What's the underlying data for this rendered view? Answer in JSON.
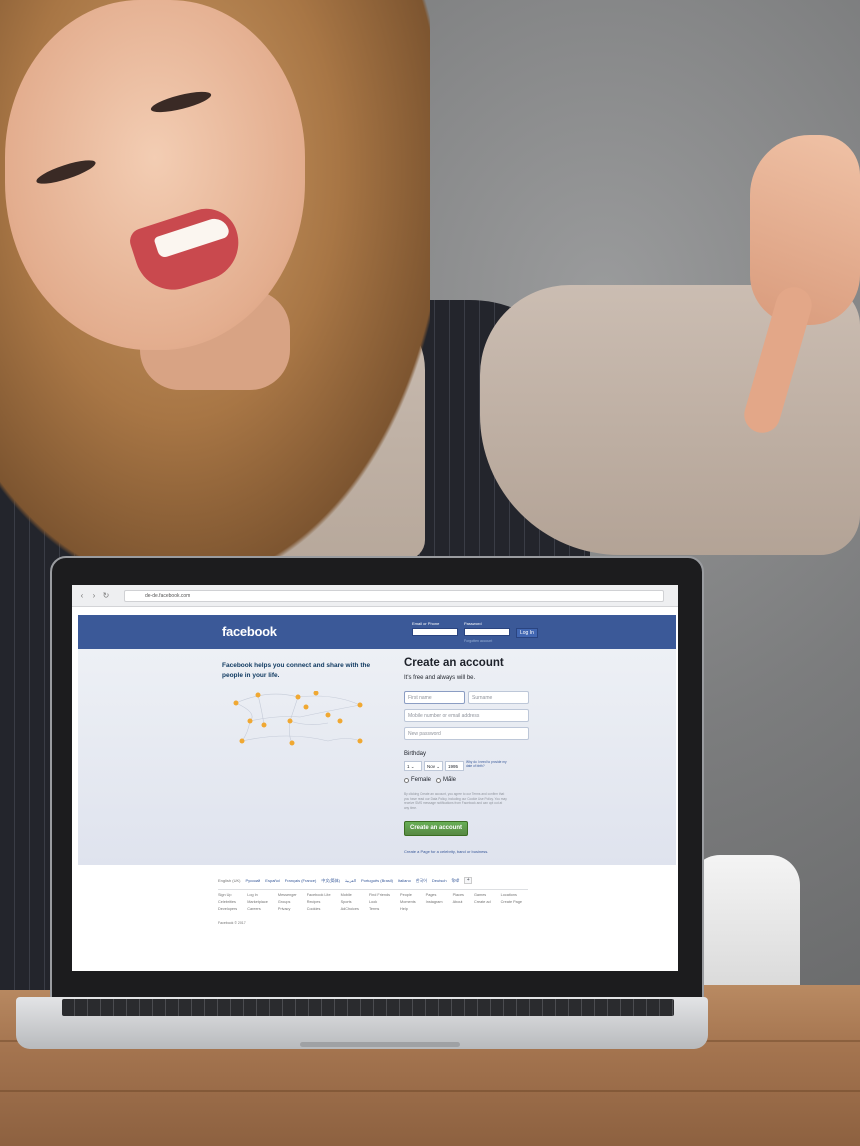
{
  "browser": {
    "url": "de-de.facebook.com",
    "nav_icons": [
      "back-arrow-icon",
      "forward-arrow-icon",
      "reload-icon"
    ]
  },
  "header": {
    "logo": "facebook",
    "email_label": "Email or Phone",
    "password_label": "Password",
    "login_button": "Log In",
    "forgot_link": "Forgotten account"
  },
  "main": {
    "tagline": "Facebook helps you connect and share with the people in your life.",
    "signup_title": "Create an account",
    "signup_subtitle": "It's free and always will be.",
    "first_name_placeholder": "First name",
    "surname_placeholder": "Surname",
    "mobile_placeholder": "Mobile number or email address",
    "password_placeholder": "New password",
    "birthday_label": "Birthday",
    "birthday_day": "1",
    "birthday_month": "Nov",
    "birthday_year": "1995",
    "why_birthday": "Why do I need to provide my date of birth?",
    "gender_female": "Female",
    "gender_male": "Male",
    "terms": "By clicking Create an account, you agree to our Terms and confirm that you have read our Data Policy, including our Cookie Use Policy. You may receive SMS message notifications from Facebook and can opt out at any time.",
    "create_button": "Create an account",
    "create_page": "Create a Page for a celebrity, band or business."
  },
  "footer": {
    "languages": [
      "English (UK)",
      "Русский",
      "Español",
      "Français (France)",
      "中文(简体)",
      "العربية",
      "Português (Brasil)",
      "Italiano",
      "한국어",
      "Deutsch",
      "हिन्दी"
    ],
    "links": [
      "Sign Up",
      "Log In",
      "Messenger",
      "Facebook Lite",
      "Mobile",
      "Find Friends",
      "People",
      "Pages",
      "Places",
      "Games",
      "Locations",
      "Celebrities",
      "Marketplace",
      "Groups",
      "Recipes",
      "Sports",
      "Look",
      "Moments",
      "Instagram",
      "About",
      "Create ad",
      "Create Page",
      "Developers",
      "Careers",
      "Privacy",
      "Cookies",
      "AdChoices",
      "Terms",
      "Help"
    ],
    "copyright": "Facebook © 2017"
  },
  "colors": {
    "brand_blue": "#3b5998",
    "create_green": "#67ae55"
  }
}
